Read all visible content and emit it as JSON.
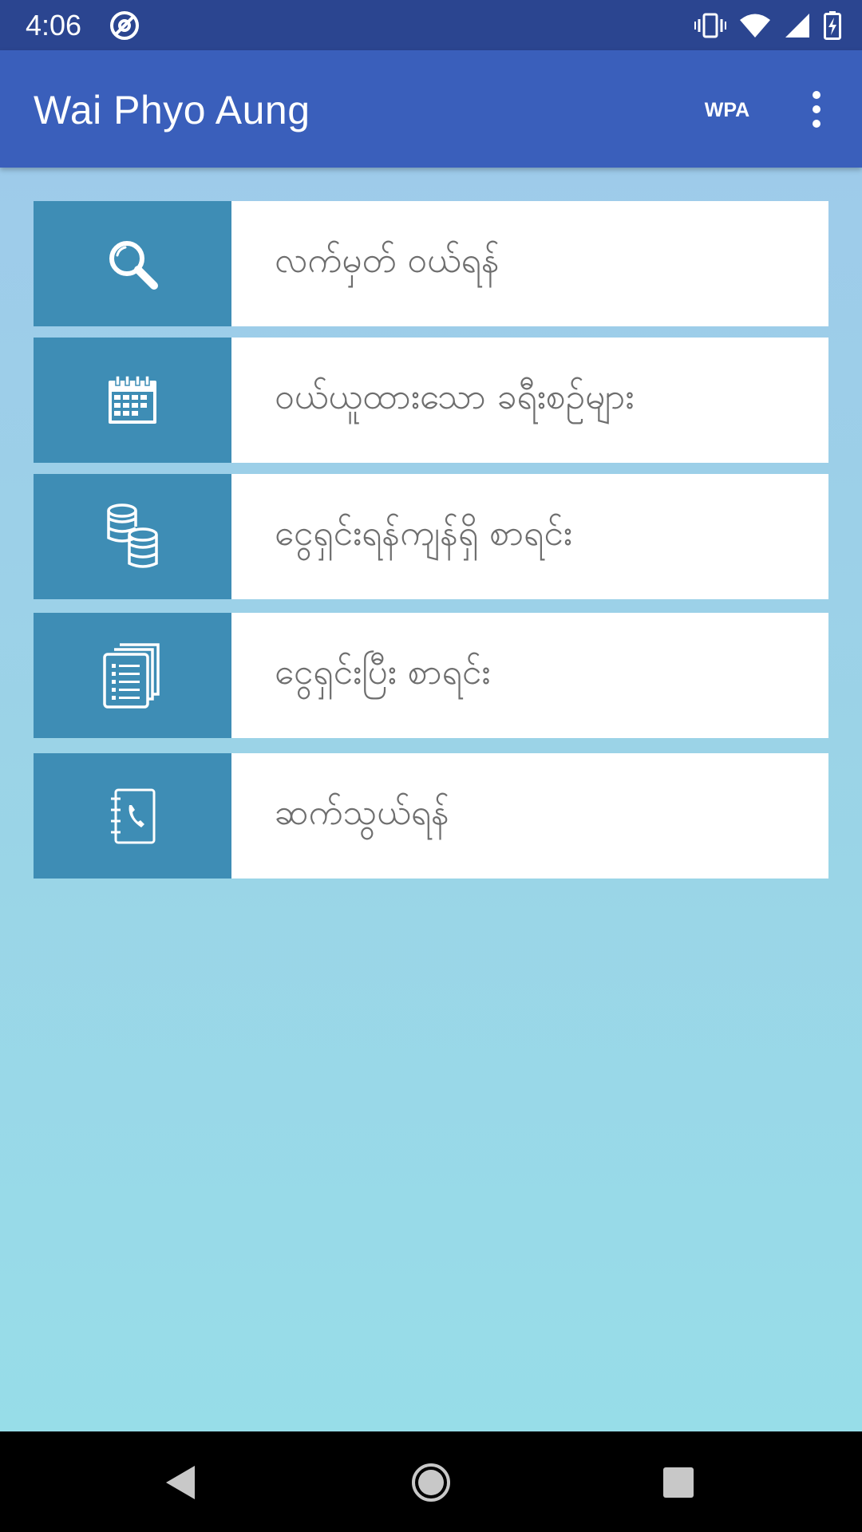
{
  "status_bar": {
    "time": "4:06",
    "icons": [
      "at-sign-notification-icon",
      "vibrate-icon",
      "wifi-icon",
      "cell-signal-icon",
      "battery-charging-icon"
    ]
  },
  "app_bar": {
    "title": "Wai Phyo Aung",
    "action_label": "WPA",
    "overflow_icon": "more-vertical-icon"
  },
  "menu": {
    "items": [
      {
        "label": "လက်မှတ် ဝယ်ရန်",
        "icon": "search-icon"
      },
      {
        "label": "ဝယ်ယူထားသော ခရီးစဉ်များ",
        "icon": "calendar-icon"
      },
      {
        "label": "ငွေရှင်းရန်ကျန်ရှိ စာရင်း",
        "icon": "coins-stack-icon"
      },
      {
        "label": "ငွေရှင်းပြီး စာရင်း",
        "icon": "documents-list-icon"
      },
      {
        "label": "ဆက်သွယ်ရန်",
        "icon": "phone-book-icon"
      }
    ]
  },
  "nav_bar": {
    "icons": [
      "back-icon",
      "home-icon",
      "recents-icon"
    ]
  },
  "colors": {
    "status_bar": "#2b4590",
    "app_bar": "#3a5fbb",
    "icon_tile": "#3e8db5",
    "background_top": "#9ecbea",
    "background_bottom": "#97dde8",
    "label_text": "#6e6e6e"
  }
}
